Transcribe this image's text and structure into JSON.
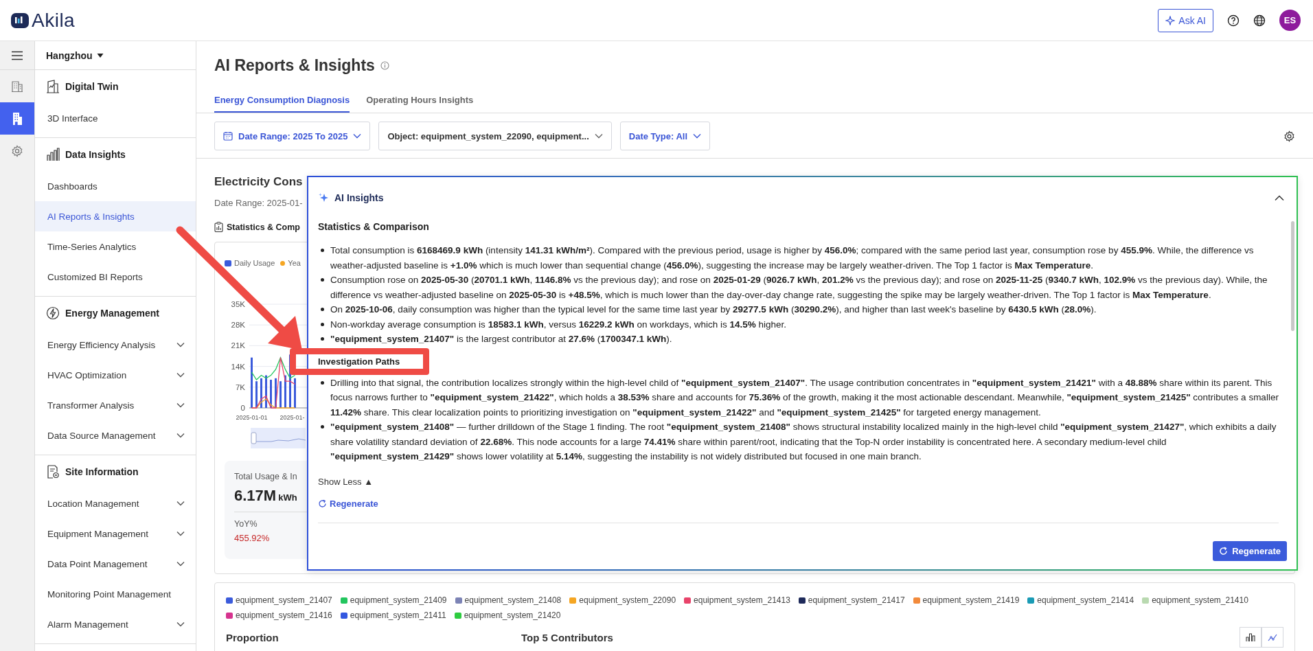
{
  "topbar": {
    "logo": "Akila",
    "ask_ai": "Ask AI",
    "avatar": "ES"
  },
  "rail": {
    "items": [
      {
        "selected": false
      },
      {
        "selected": true
      },
      {
        "selected": false
      }
    ]
  },
  "sidebar": {
    "location": "Hangzhou",
    "sections": [
      {
        "title": "Digital Twin",
        "items": [
          {
            "label": "3D Interface",
            "selected": false
          }
        ]
      },
      {
        "title": "Data Insights",
        "items": [
          {
            "label": "Dashboards",
            "selected": false
          },
          {
            "label": "AI Reports & Insights",
            "selected": true
          },
          {
            "label": "Time-Series Analytics",
            "selected": false
          },
          {
            "label": "Customized BI Reports",
            "selected": false
          }
        ]
      },
      {
        "title": "Energy Management",
        "items": [
          {
            "label": "Energy Efficiency Analysis",
            "selected": false,
            "expanded": false
          },
          {
            "label": "HVAC Optimization",
            "selected": false,
            "expanded": false
          },
          {
            "label": "Transformer Analysis",
            "selected": false,
            "expanded": false
          },
          {
            "label": "Data Source Management",
            "selected": false,
            "expanded": false
          }
        ]
      },
      {
        "title": "Site Information",
        "items": [
          {
            "label": "Location Management",
            "selected": false,
            "expanded": false
          },
          {
            "label": "Equipment Management",
            "selected": false,
            "expanded": false
          },
          {
            "label": "Data Point Management",
            "selected": false,
            "expanded": false
          },
          {
            "label": "Monitoring Point Management",
            "selected": false
          },
          {
            "label": "Alarm Management",
            "selected": false,
            "expanded": false
          }
        ]
      }
    ]
  },
  "page": {
    "title": "AI Reports & Insights",
    "tabs": [
      {
        "label": "Energy Consumption Diagnosis",
        "selected": true
      },
      {
        "label": "Operating Hours Insights",
        "selected": false
      }
    ],
    "filters": [
      {
        "label": "Date Range: 2025 To 2025",
        "active": true
      },
      {
        "label": "Object: equipment_system_22090, equipment...",
        "active": false
      },
      {
        "label": "Date Type: All",
        "active": true
      }
    ]
  },
  "report": {
    "title": "Electricity Cons",
    "date_range": "Date Range: 2025-01-",
    "section": "Statistics & Comp",
    "chart_data": {
      "type": "bar",
      "grid": true,
      "ylim": [
        0,
        35000
      ],
      "yticks": [
        {
          "value": 35000,
          "label": "35K"
        },
        {
          "value": 28000,
          "label": "28K"
        },
        {
          "value": 21000,
          "label": "21K"
        },
        {
          "value": 14000,
          "label": "14K"
        },
        {
          "value": 7000,
          "label": "7K"
        },
        {
          "value": 0,
          "label": "0"
        }
      ],
      "series": [
        {
          "name": "Daily Usage",
          "color": "#3b5bdb",
          "values": [
            17000,
            9000,
            10000,
            11000,
            9500,
            10000,
            9000,
            11000,
            18000,
            10000
          ]
        },
        {
          "name": "Yea",
          "type": "line",
          "color": "#f5a623",
          "values": [
            0,
            0,
            2000,
            3000,
            1000,
            0,
            0,
            0,
            0,
            0
          ]
        },
        {
          "type": "line",
          "color": "#22c55e",
          "values": [
            12000,
            9500,
            11000,
            10000,
            11000,
            13000,
            17000,
            13000,
            10000,
            11000
          ]
        },
        {
          "type": "line",
          "color": "#e8436a",
          "values": [
            0,
            0,
            3000,
            4000,
            0,
            0,
            17000,
            9000,
            9000,
            8000
          ]
        }
      ]
    },
    "x_labels": [
      "2025-01-01",
      "2025-01-"
    ],
    "summary": {
      "label": "Total Usage & In",
      "value": "6.17M",
      "unit": "kWh",
      "yoy_label": "YoY%",
      "yoy_value": "455.92%"
    }
  },
  "ai_insights": {
    "title": "AI Insights",
    "expanded": true,
    "sections": [
      {
        "heading": "Statistics & Comparison",
        "highlighted": false,
        "bullets": [
          "Total consumption is **6168469.9 kWh** (intensity **141.31 kWh/m²**). Compared with the previous period, usage is higher by **456.0%**; compared with the same period last year, consumption rose by **455.9%**. While, the difference vs weather-adjusted baseline is **+1.0%** which is much lower than sequential change (**456.0%**), suggesting the increase may be largely weather-driven. The Top 1 factor is **Max Temperature**.",
          "Consumption rose on **2025-05-30** (**20701.1 kWh**, **1146.8%** vs the previous day); and rose on **2025-01-29** (**9026.7 kWh**, **201.2%** vs the previous day); and rose on **2025-11-25** (**9340.7 kWh**, **102.9%** vs the previous day). While, the difference vs weather-adjusted baseline on **2025-05-30** is **+48.5%**, which is much lower than the day-over-day change rate, suggesting the spike may be largely weather-driven. The Top 1 factor is **Max Temperature**.",
          "On **2025-10-06**, daily consumption was higher than the typical level for the same time last year by **29277.5 kWh** (**30290.2%**), and higher than last week's baseline by **6430.5 kWh** (**28.0%**).",
          "Non-workday average consumption is **18583.1 kWh**, versus **16229.2 kWh** on workdays, which is **14.5%** higher.",
          "**\"equipment_system_21407\"** is the largest contributor at **27.6%** (**1700347.1 kWh**)."
        ]
      },
      {
        "heading": "Investigation Paths",
        "highlighted": true,
        "bullets": [
          "Drilling into that signal, the contribution localizes strongly within the high-level child of **\"equipment_system_21407\"**. The usage contribution concentrates in **\"equipment_system_21421\"** with a **48.88%** share within its parent. This focus narrows further to **\"equipment_system_21422\"**, which holds a **38.53%** share and accounts for **75.36%** of the growth, making it the most actionable descendant. Meanwhile, **\"equipment_system_21425\"** contributes a smaller **11.42%** share. This clear localization points to prioritizing investigation on **\"equipment_system_21422\"** and **\"equipment_system_21425\"** for targeted energy management.",
          "**\"equipment_system_21408\"** — further drilldown of the Stage 1 finding. The root **\"equipment_system_21408\"** shows structural instability localized mainly in the high-level child **\"equipment_system_21427\"**, which exhibits a daily share volatility standard deviation of **22.68%**. This node accounts for a large **74.41%** share within parent/root, indicating that the Top-N order instability is concentrated here. A secondary medium-level child **\"equipment_system_21429\"** shows lower volatility at **5.14%**, suggesting the instability is not widely distributed but focused in one main branch."
        ]
      }
    ],
    "show_less": "Show Less ▲",
    "regenerate_link": "Regenerate",
    "regenerate_button": "Regenerate"
  },
  "breakdown": {
    "legend": [
      {
        "label": "equipment_system_21407",
        "color": "#3b5bdb"
      },
      {
        "label": "equipment_system_21409",
        "color": "#22c55e"
      },
      {
        "label": "equipment_system_21408",
        "color": "#7c83b5"
      },
      {
        "label": "equipment_system_22090",
        "color": "#f5a623"
      },
      {
        "label": "equipment_system_21413",
        "color": "#e8436a"
      },
      {
        "label": "equipment_system_21417",
        "color": "#1e2a5a"
      },
      {
        "label": "equipment_system_21419",
        "color": "#f28a3b"
      },
      {
        "label": "equipment_system_21414",
        "color": "#1a9bb5"
      },
      {
        "label": "equipment_system_21410",
        "color": "#b9d9b0"
      },
      {
        "label": "equipment_system_21416",
        "color": "#d6338f"
      },
      {
        "label": "equipment_system_21411",
        "color": "#3358e0"
      },
      {
        "label": "equipment_system_21420",
        "color": "#2ecc40"
      }
    ],
    "proportion": "Proportion",
    "top_contributors": "Top 5 Contributors"
  }
}
